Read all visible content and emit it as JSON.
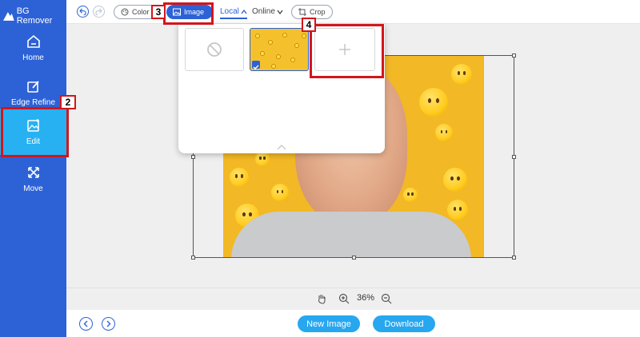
{
  "app": {
    "title": "BG Remover"
  },
  "sidebar": {
    "items": [
      {
        "label": "Home",
        "icon": "home-icon"
      },
      {
        "label": "Edge Refine",
        "icon": "edge-refine-icon"
      },
      {
        "label": "Edit",
        "icon": "edit-image-icon",
        "active": true
      },
      {
        "label": "Move",
        "icon": "move-arrows-icon"
      }
    ]
  },
  "toolbar": {
    "color_label": "Color",
    "image_label": "Image",
    "local_tab": "Local",
    "online_tab": "Online",
    "crop_label": "Crop"
  },
  "zoom": {
    "level": "36%"
  },
  "bottom": {
    "new_image": "New Image",
    "download": "Download"
  },
  "callouts": [
    "2",
    "3",
    "4"
  ],
  "colors": {
    "sidebar": "#2d62d6",
    "active": "#27b1f2",
    "accent": "#2d62d6",
    "cta": "#27a7ef",
    "callout": "#d3151c"
  }
}
